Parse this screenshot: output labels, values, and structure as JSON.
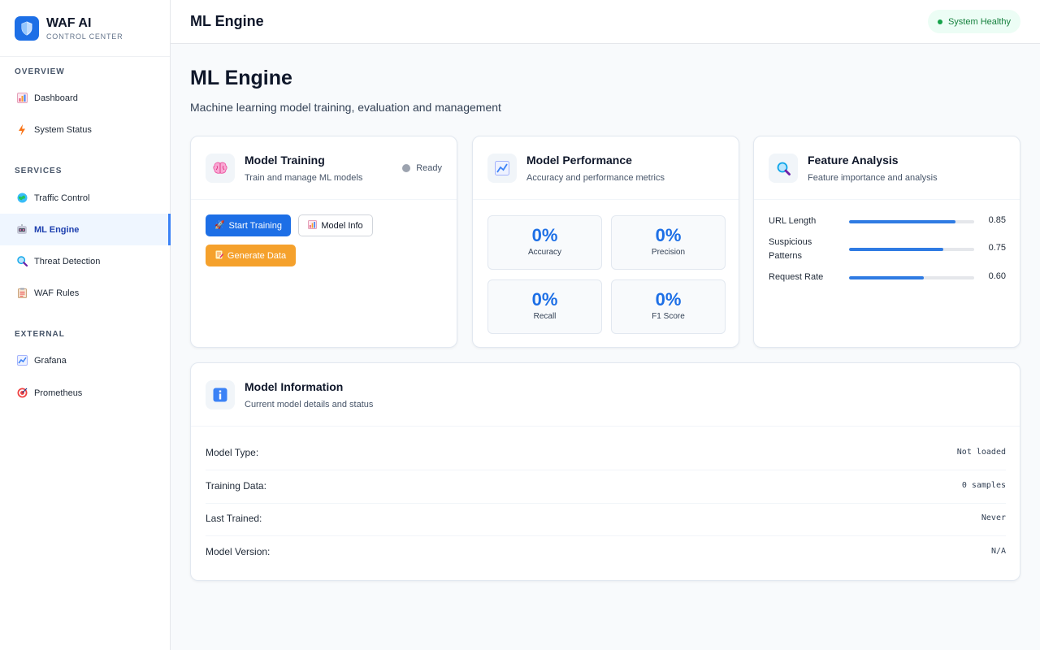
{
  "sidebar": {
    "brand_title": "WAF AI",
    "brand_subtitle": "CONTROL CENTER",
    "sections": {
      "overview": "OVERVIEW",
      "services": "SERVICES",
      "external": "EXTERNAL"
    },
    "items": [
      {
        "label": "Dashboard",
        "icon": "bar-chart-icon"
      },
      {
        "label": "System Status",
        "icon": "lightning-icon"
      },
      {
        "label": "Traffic Control",
        "icon": "globe-icon"
      },
      {
        "label": "ML Engine",
        "icon": "robot-icon",
        "active": true
      },
      {
        "label": "Threat Detection",
        "icon": "magnifier-icon"
      },
      {
        "label": "WAF Rules",
        "icon": "clipboard-icon"
      },
      {
        "label": "Grafana",
        "icon": "line-chart-icon"
      },
      {
        "label": "Prometheus",
        "icon": "target-icon"
      }
    ]
  },
  "header": {
    "title": "ML Engine",
    "status": "System Healthy",
    "status_color": "#16a34a"
  },
  "page": {
    "title": "ML Engine",
    "subtitle": "Machine learning model training, evaluation and management"
  },
  "training": {
    "title": "Model Training",
    "subtitle": "Train and manage ML models",
    "status": "Ready",
    "start_label": "Start Training",
    "info_label": "Model Info",
    "generate_label": "Generate Data"
  },
  "performance": {
    "title": "Model Performance",
    "subtitle": "Accuracy and performance metrics",
    "metrics": [
      {
        "value": "0%",
        "label": "Accuracy"
      },
      {
        "value": "0%",
        "label": "Precision"
      },
      {
        "value": "0%",
        "label": "Recall"
      },
      {
        "value": "0%",
        "label": "F1 Score"
      }
    ]
  },
  "features": {
    "title": "Feature Analysis",
    "subtitle": "Feature importance and analysis",
    "items": [
      {
        "name": "URL Length",
        "value": "0.85",
        "level": 0.85
      },
      {
        "name": "Suspicious Patterns",
        "value": "0.75",
        "level": 0.75
      },
      {
        "name": "Request Rate",
        "value": "0.60",
        "level": 0.6
      }
    ]
  },
  "model_info": {
    "title": "Model Information",
    "subtitle": "Current model details and status",
    "rows": [
      {
        "label": "Model Type:",
        "value": "Not loaded"
      },
      {
        "label": "Training Data:",
        "value": "0 samples"
      },
      {
        "label": "Last Trained:",
        "value": "Never"
      },
      {
        "label": "Model Version:",
        "value": "N/A"
      }
    ]
  },
  "colors": {
    "accent": "#1d6fe6",
    "warning": "#f5a12c"
  }
}
